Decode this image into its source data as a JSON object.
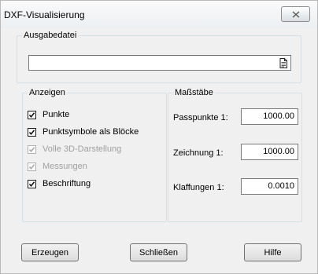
{
  "window": {
    "title": "DXF-Visualisierung",
    "close_label": "ⵝ"
  },
  "output": {
    "legend": "Ausgabedatei",
    "file_value": ""
  },
  "display": {
    "legend": "Anzeigen",
    "items": [
      {
        "label": "Punkte",
        "checked": true,
        "enabled": true
      },
      {
        "label": "Punktsymbole als Blöcke",
        "checked": true,
        "enabled": true
      },
      {
        "label": "Volle 3D-Darstellung",
        "checked": true,
        "enabled": false
      },
      {
        "label": "Messungen",
        "checked": true,
        "enabled": false
      },
      {
        "label": "Beschriftung",
        "checked": true,
        "enabled": true
      }
    ]
  },
  "scales": {
    "legend": "Maßstäbe",
    "fields": [
      {
        "label": "Passpunkte 1:",
        "value": "1000.00"
      },
      {
        "label": "Zeichnung 1:",
        "value": "1000.00"
      },
      {
        "label": "Klaffungen 1:",
        "value": "0.0010"
      }
    ]
  },
  "buttons": {
    "create": "Erzeugen",
    "close": "Schließen",
    "help": "Hilfe"
  }
}
